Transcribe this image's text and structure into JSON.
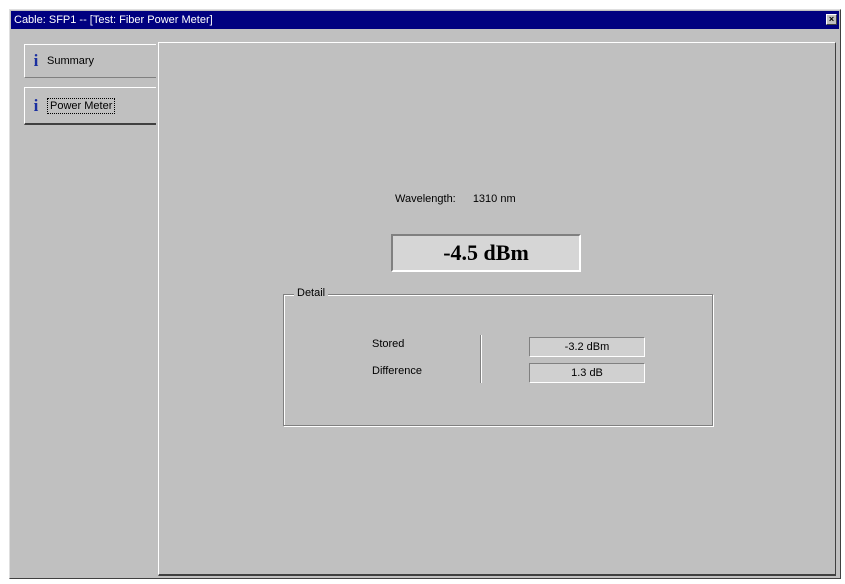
{
  "window": {
    "title": "Cable: SFP1 -- [Test: Fiber Power Meter]",
    "close_glyph": "×"
  },
  "tabs": [
    {
      "label": "Summary",
      "icon": "info-icon",
      "icon_glyph": "i"
    },
    {
      "label": "Power Meter",
      "icon": "info-icon",
      "icon_glyph": "i",
      "selected": true
    }
  ],
  "measurement": {
    "wavelength_label": "Wavelength:",
    "wavelength_value": "1310 nm",
    "reading": "-4.5 dBm"
  },
  "detail": {
    "title": "Detail",
    "stored_label": "Stored",
    "stored_value": "-3.2 dBm",
    "difference_label": "Difference",
    "difference_value": "1.3 dB"
  },
  "colors": {
    "titlebar": "#000080",
    "face": "#c0c0c0",
    "icon": "#1a2fa0"
  }
}
